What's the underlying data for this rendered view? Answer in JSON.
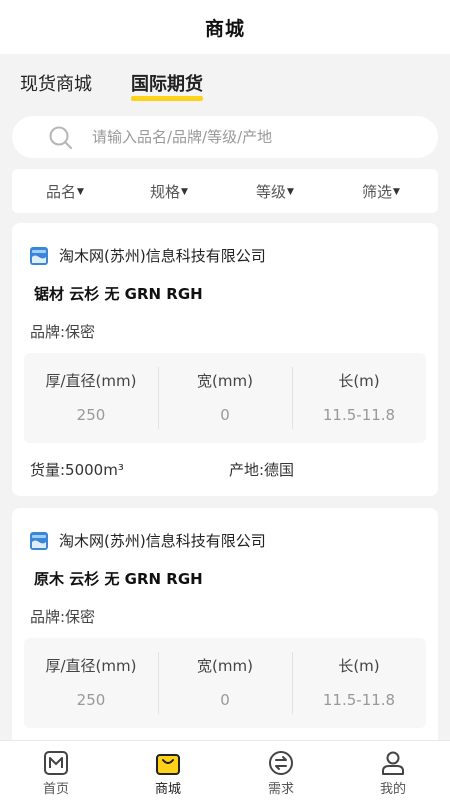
{
  "header": {
    "title": "商城"
  },
  "tabs": [
    {
      "label": "现货商城",
      "active": false
    },
    {
      "label": "国际期货",
      "active": true
    }
  ],
  "search": {
    "placeholder": "请输入品名/品牌/等级/产地"
  },
  "filters": [
    {
      "label": "品名"
    },
    {
      "label": "规格"
    },
    {
      "label": "等级"
    },
    {
      "label": "筛选"
    }
  ],
  "listings": [
    {
      "company": "淘木网(苏州)信息科技有限公司",
      "product": "锯材 云杉 无 GRN RGH",
      "brand": "品牌:保密",
      "specs": [
        {
          "label": "厚/直径(mm)",
          "value": "250"
        },
        {
          "label": "宽(mm)",
          "value": "0"
        },
        {
          "label": "长(m)",
          "value": "11.5-11.8"
        }
      ],
      "quantity": "货量:5000m³",
      "origin": "产地:德国"
    },
    {
      "company": "淘木网(苏州)信息科技有限公司",
      "product": "原木 云杉 无 GRN RGH",
      "brand": "品牌:保密",
      "specs": [
        {
          "label": "厚/直径(mm)",
          "value": "250"
        },
        {
          "label": "宽(mm)",
          "value": "0"
        },
        {
          "label": "长(m)",
          "value": "11.5-11.8"
        }
      ]
    }
  ],
  "nav": [
    {
      "label": "首页",
      "icon": "home-m-icon"
    },
    {
      "label": "商城",
      "icon": "shopping-bag-icon",
      "active": true
    },
    {
      "label": "需求",
      "icon": "exchange-icon"
    },
    {
      "label": "我的",
      "icon": "user-icon"
    }
  ],
  "colors": {
    "accent": "#ffd21a",
    "background": "#f3f3f3",
    "card": "#ffffff",
    "logo_blue": "#3a86d8"
  }
}
